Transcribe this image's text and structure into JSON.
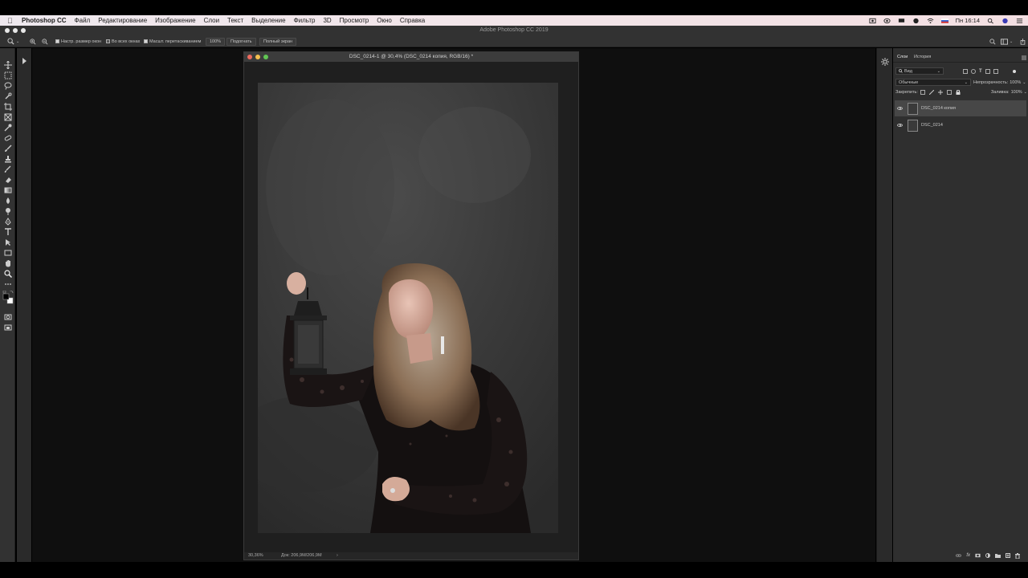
{
  "menubar": {
    "app_name": "Photoshop CC",
    "items": [
      "Файл",
      "Редактирование",
      "Изображение",
      "Слои",
      "Текст",
      "Выделение",
      "Фильтр",
      "3D",
      "Просмотр",
      "Окно",
      "Справка"
    ],
    "clock": "Пн 16:14",
    "status_icons": [
      "screen-record-icon",
      "eye-icon",
      "cast-icon",
      "battery-icon",
      "wifi-icon",
      "flag-icon",
      "search-icon",
      "siri-icon",
      "notification-icon"
    ]
  },
  "app": {
    "title": "Adobe Photoshop CC 2019"
  },
  "options": {
    "resize_windows": "Настр. размер окон",
    "all_windows": "Во всех окнах",
    "scrubby_zoom": "Масшт. перетаскиванием",
    "zoom_100": "100%",
    "fit_screen": "Подогнать",
    "fill_screen": "Полный экран"
  },
  "document": {
    "title": "DSC_0214-1 @ 30,4% (DSC_0214 копия, RGB/16) *",
    "zoom": "30,36%",
    "doc_size": "Док: 206,9M/206,9M"
  },
  "layers_panel": {
    "tabs": [
      "Слои",
      "История"
    ],
    "filter_kind": "Вид",
    "blend_mode": "Обычные",
    "opacity_label": "Непрозрачность:",
    "opacity_value": "100%",
    "lock_label": "Закрепить:",
    "fill_label": "Заливка:",
    "fill_value": "100%",
    "layers": [
      {
        "name": "DSC_0214 копия",
        "selected": true
      },
      {
        "name": "DSC_0214",
        "selected": false
      }
    ]
  },
  "colors": {
    "accent_red": "#ed6a5e",
    "accent_yellow": "#f5bf4f",
    "accent_green": "#61c554"
  }
}
